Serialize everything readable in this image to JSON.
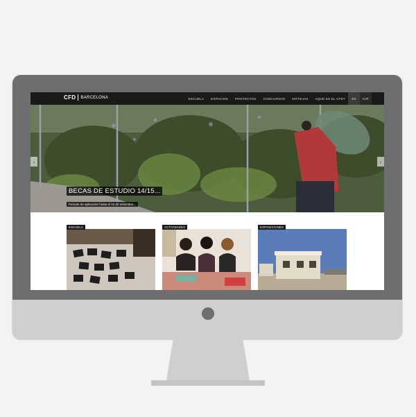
{
  "nav": {
    "logo_mark": "CFD",
    "logo_text": "BARCELONA",
    "items": [
      "ESCUELA",
      "ESPACIOS",
      "PROYECTOS",
      "CONCURSOS",
      "NOTICIAS",
      "AQUÉ ES EL CFD?"
    ],
    "languages": [
      "ES",
      "CAT"
    ]
  },
  "hero": {
    "title": "BECAS DE ESTUDIO 14/15...",
    "subtitle": "Periodo de aplicación hasta el 15 de setiembre...",
    "prev_icon": "‹",
    "next_icon": "›"
  },
  "cards": [
    {
      "tag": "ESCUELA"
    },
    {
      "tag": "ACTIVIDADES"
    },
    {
      "tag": "EXPOSICIONES"
    }
  ],
  "colors": {
    "page_bg": "#f2f3f3",
    "bezel": "#6d6e70",
    "chin": "#cfcfcf",
    "navbar": "#1a1a1a"
  }
}
